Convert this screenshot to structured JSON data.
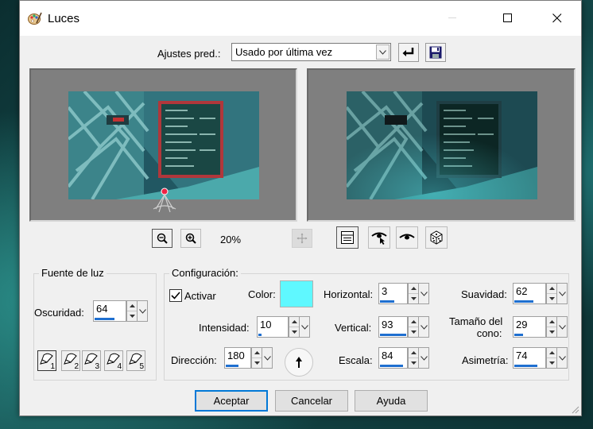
{
  "window": {
    "title": "Luces",
    "icon": "paint-palette-icon",
    "controls": {
      "minimize": "minimize-icon",
      "maximize": "maximize-icon",
      "close": "close-icon"
    }
  },
  "presets": {
    "label": "Ajustes pred.:",
    "selected": "Usado por última vez",
    "reset_icon": "reset-arrow-icon",
    "save_icon": "floppy-disk-icon"
  },
  "preview": {
    "zoom_level": "20%",
    "icons": {
      "zoom_out": "zoom-out-icon",
      "zoom_in": "zoom-in-icon",
      "pan": "pan-move-icon",
      "view_toggle": "split-view-icon",
      "proof": "eye-pointer-icon",
      "auto_proof": "eye-icon",
      "randomize": "dice-icon"
    }
  },
  "light_source": {
    "group_title": "Fuente de luz",
    "darkness_label": "Oscuridad:",
    "darkness_value": "64",
    "darkness_fraction": 0.64,
    "selectors": [
      "1",
      "2",
      "3",
      "4",
      "5"
    ],
    "selected_index": 0
  },
  "config": {
    "group_title": "Configuración:",
    "enable_label": "Activar",
    "enable_checked": true,
    "color_label": "Color:",
    "color_value": "#5ff8ff",
    "intensity_label": "Intensidad:",
    "intensity_value": "10",
    "intensity_fraction": 0.1,
    "direction_label": "Dirección:",
    "direction_value": "180",
    "direction_fraction": 0.5,
    "horizontal_label": "Horizontal:",
    "horizontal_value": "3",
    "horizontal_fraction": 0.52,
    "vertical_label": "Vertical:",
    "vertical_value": "93",
    "vertical_fraction": 0.96,
    "scale_label": "Escala:",
    "scale_value": "84",
    "scale_fraction": 0.84,
    "softness_label": "Suavidad:",
    "softness_value": "62",
    "softness_fraction": 0.62,
    "cone_size_label_line1": "Tamaño del",
    "cone_size_label_line2": "cono:",
    "cone_size_value": "29",
    "cone_size_fraction": 0.29,
    "asymmetry_label": "Asimetría:",
    "asymmetry_value": "74",
    "asymmetry_fraction": 0.74
  },
  "buttons": {
    "ok": "Aceptar",
    "cancel": "Cancelar",
    "help": "Ayuda"
  }
}
